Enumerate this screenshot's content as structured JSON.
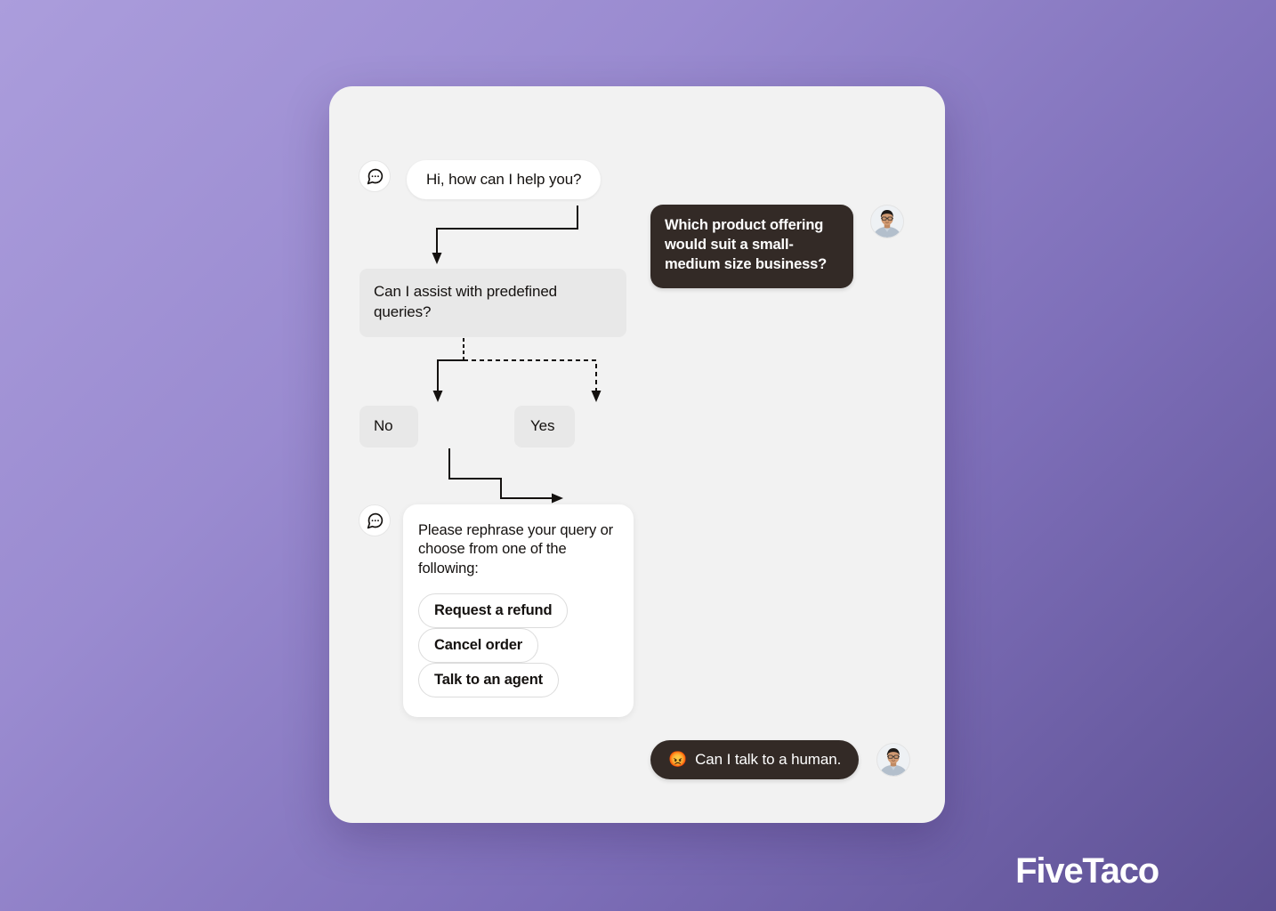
{
  "brand": {
    "name": "FiveTaco"
  },
  "colors": {
    "background_top_left": "#ab9ddc",
    "background_bottom_right": "#5d5093",
    "card_background": "#f2f2f2",
    "user_bubble": "#332a26",
    "bot_bubble": "#ffffff",
    "flow_node": "#e8e8e8",
    "text_dark": "#14110f",
    "text_light": "#ffffff"
  },
  "chat": {
    "messages": [
      {
        "id": "bot-greeting",
        "sender": "bot",
        "icon": "chat-bubble-icon",
        "text": "Hi, how can I help you?"
      },
      {
        "id": "user-question",
        "sender": "user",
        "avatar": "user-avatar-photo",
        "text": "Which product offering would suit a small-medium size business?"
      },
      {
        "id": "user-human-request",
        "sender": "user",
        "avatar": "user-avatar-photo",
        "emoji": "😡",
        "text": "Can I talk to a human."
      }
    ]
  },
  "flow": {
    "decision_node": {
      "id": "predefined-queries",
      "text": "Can I assist with predefined queries?"
    },
    "branches": [
      {
        "id": "no",
        "label": "No",
        "line_style": "solid"
      },
      {
        "id": "yes",
        "label": "Yes",
        "line_style": "dotted"
      }
    ]
  },
  "options_card": {
    "icon": "chat-bubble-icon",
    "prompt": "Please rephrase your query or choose from one of the following:",
    "options": [
      {
        "id": "request-refund",
        "label": "Request a refund"
      },
      {
        "id": "cancel-order",
        "label": "Cancel order"
      },
      {
        "id": "talk-to-agent",
        "label": "Talk to an agent"
      }
    ]
  }
}
